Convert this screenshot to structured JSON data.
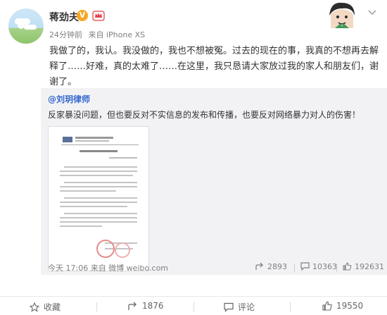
{
  "post": {
    "author": "蒋劲夫",
    "time": "24分钟前",
    "source": "来自 iPhone XS",
    "text": "我做了的，我认。我没做的，我也不想被冤。过去的现在的事，我真的不想再去解释了……好难，真的太难了……在这里，我只恳请大家放过我的家人和朋友们，谢谢了。"
  },
  "repost": {
    "author": "@刘玥律师",
    "text": "反家暴没问题，但也要反对不实信息的发布和传播，也要反对网络暴力对人的伤害！",
    "time_source": "今天 17:06 来自 微博 weibo.com",
    "forward_count": "2893",
    "comment_count": "10363",
    "like_count": "192631"
  },
  "actions": {
    "favorite": "收藏",
    "forward": "1876",
    "comment": "评论",
    "like": "19550"
  },
  "colors": {
    "link": "#3366cc",
    "muted": "#808080",
    "repost_bg": "#f2f2f5",
    "vip": "#f5a623"
  },
  "icons": [
    "vip-badge-icon",
    "crown-icon",
    "caret-down-icon",
    "star-icon",
    "forward-icon",
    "comment-icon",
    "thumbs-up-icon"
  ]
}
